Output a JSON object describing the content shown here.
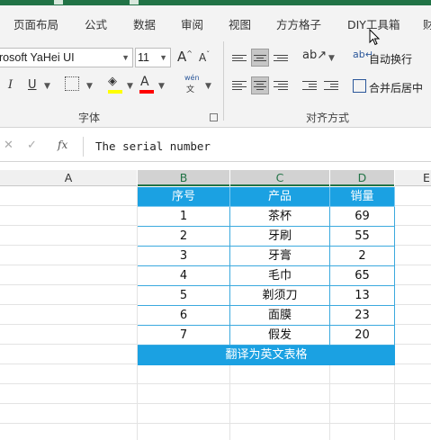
{
  "ribbon_tabs": [
    "页面布局",
    "公式",
    "数据",
    "审阅",
    "视图",
    "方方格子",
    "DIY工具箱",
    "财"
  ],
  "font": {
    "name": "rosoft YaHei UI",
    "size": "11",
    "grow_label": "A",
    "shrink_label": "A",
    "italic_label": "I",
    "underline_label": "U",
    "phonetic_label": "wén",
    "highlight_color": "#ffff00",
    "font_color": "#ff0000",
    "group_label": "字体"
  },
  "alignment": {
    "wrap_text": "自动换行",
    "merge_center": "合并后居中",
    "group_label": "对齐方式"
  },
  "formula_bar": {
    "cancel_mark": "✕",
    "enter_mark": "✓",
    "fx_label": "fx",
    "content": "The serial number"
  },
  "columns": [
    "A",
    "B",
    "C",
    "D",
    "E"
  ],
  "table": {
    "headers": [
      "序号",
      "产品",
      "销量"
    ],
    "rows": [
      [
        "1",
        "茶杯",
        "69"
      ],
      [
        "2",
        "牙刷",
        "55"
      ],
      [
        "3",
        "牙膏",
        "2"
      ],
      [
        "4",
        "毛巾",
        "65"
      ],
      [
        "5",
        "剃须刀",
        "13"
      ],
      [
        "6",
        "面膜",
        "23"
      ],
      [
        "7",
        "假发",
        "20"
      ]
    ],
    "footer": "翻译为英文表格"
  },
  "colors": {
    "accent": "#217346",
    "table_header": "#1ba1e2",
    "table_border": "#3ba9de"
  }
}
